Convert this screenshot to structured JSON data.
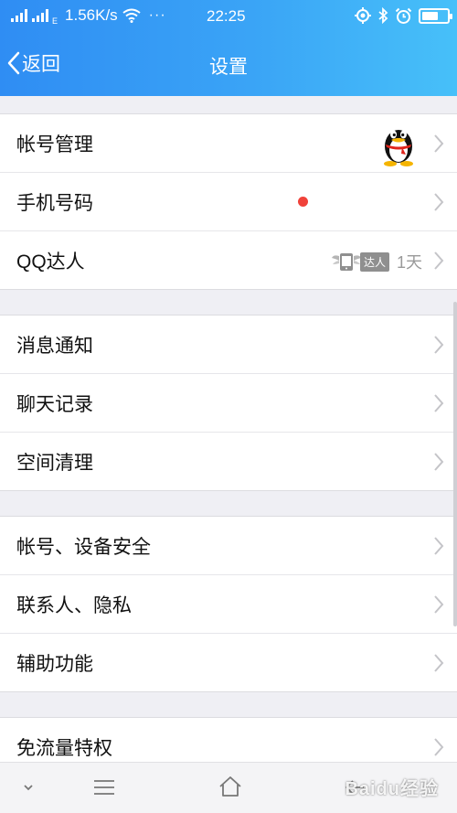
{
  "status_bar": {
    "network_speed": "1.56K/s",
    "more": "···",
    "time": "22:25",
    "battery_level": 0.65
  },
  "header": {
    "back_label": "返回",
    "title": "设置"
  },
  "groups": [
    {
      "items": [
        {
          "label": "帐号管理"
        },
        {
          "label": "手机号码"
        },
        {
          "label": "QQ达人",
          "badge": "达人",
          "value": "1天"
        }
      ]
    },
    {
      "items": [
        {
          "label": "消息通知"
        },
        {
          "label": "聊天记录"
        },
        {
          "label": "空间清理"
        }
      ]
    },
    {
      "items": [
        {
          "label": "帐号、设备安全"
        },
        {
          "label": "联系人、隐私"
        },
        {
          "label": "辅助功能"
        }
      ]
    },
    {
      "items": [
        {
          "label": "免流量特权"
        }
      ]
    }
  ],
  "watermark": "Baidu经验",
  "colors": {
    "header_start": "#2f8df3",
    "header_end": "#47c0f9",
    "red_dot": "#f0423a",
    "background": "#efeff4"
  }
}
